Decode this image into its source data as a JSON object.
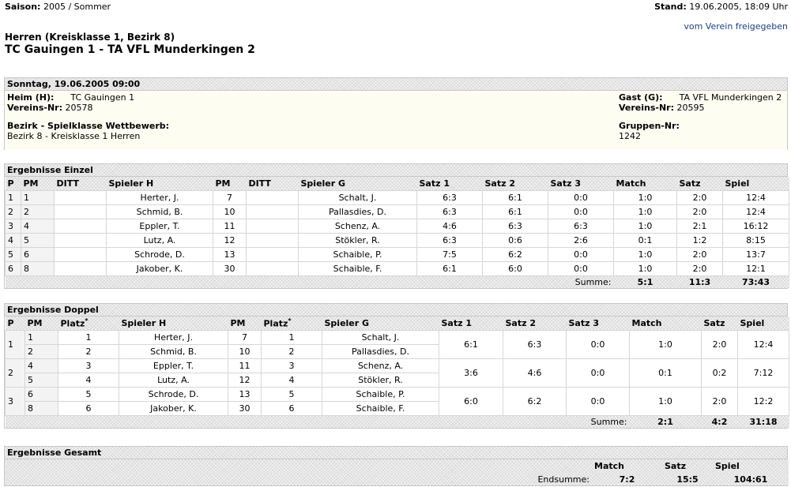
{
  "header": {
    "saison_label": "Saison:",
    "saison_value": "2005 / Sommer",
    "stand_label": "Stand:",
    "stand_value": "19.06.2005, 18:09 Uhr",
    "freigabe": "vom Verein freigegeben",
    "league": "Herren (Kreisklasse 1, Bezirk 8)",
    "match": "TC Gauingen 1 - TA VFL Munderkingen 2"
  },
  "info": {
    "date": "Sonntag, 19.06.2005 09:00",
    "heim_label": "Heim (H):",
    "heim_value": "TC Gauingen 1",
    "heim_nr_label": "Vereins-Nr:",
    "heim_nr_value": "20578",
    "gast_label": "Gast (G):",
    "gast_value": "TA VFL Munderkingen 2",
    "gast_nr_label": "Vereins-Nr:",
    "gast_nr_value": "20595",
    "bezirk_label": "Bezirk - Spielklasse Wettbewerb:",
    "bezirk_value": "Bezirk 8 - Kreisklasse 1 Herren",
    "gruppe_label": "Gruppen-Nr:",
    "gruppe_value": "1242"
  },
  "einzel": {
    "title": "Ergebnisse Einzel",
    "headers": [
      "P",
      "PM",
      "DITT",
      "Spieler H",
      "PM",
      "DITT",
      "Spieler G",
      "Satz 1",
      "Satz 2",
      "Satz 3",
      "Match",
      "Satz",
      "Spiel"
    ],
    "rows": [
      [
        "1",
        "1",
        "",
        "Herter, J.",
        "7",
        "",
        "Schalt, J.",
        "6:3",
        "6:1",
        "0:0",
        "1:0",
        "2:0",
        "12:4"
      ],
      [
        "2",
        "2",
        "",
        "Schmid, B.",
        "10",
        "",
        "Pallasdies, D.",
        "6:3",
        "6:1",
        "0:0",
        "1:0",
        "2:0",
        "12:4"
      ],
      [
        "3",
        "4",
        "",
        "Eppler, T.",
        "11",
        "",
        "Schenz, A.",
        "4:6",
        "6:3",
        "6:3",
        "1:0",
        "2:1",
        "16:12"
      ],
      [
        "4",
        "5",
        "",
        "Lutz, A.",
        "12",
        "",
        "Stökler, R.",
        "6:3",
        "0:6",
        "2:6",
        "0:1",
        "1:2",
        "8:15"
      ],
      [
        "5",
        "6",
        "",
        "Schrode, D.",
        "13",
        "",
        "Schaible, P.",
        "7:5",
        "6:2",
        "0:0",
        "1:0",
        "2:0",
        "13:7"
      ],
      [
        "6",
        "8",
        "",
        "Jakober, K.",
        "30",
        "",
        "Schaible, F.",
        "6:1",
        "6:0",
        "0:0",
        "1:0",
        "2:0",
        "12:1"
      ]
    ],
    "sum_label": "Summe:",
    "sum_match": "5:1",
    "sum_satz": "11:3",
    "sum_spiel": "73:43"
  },
  "doppel": {
    "title": "Ergebnisse Doppel",
    "headers": [
      "P",
      "PM",
      "Platz",
      "Spieler H",
      "PM",
      "Platz",
      "Spieler G",
      "Satz 1",
      "Satz 2",
      "Satz 3",
      "Match",
      "Satz",
      "Spiel"
    ],
    "star": "*",
    "pairs": [
      {
        "p": "1",
        "players": [
          [
            "1",
            "1",
            "Herter, J.",
            "7",
            "1",
            "Schalt, J."
          ],
          [
            "2",
            "2",
            "Schmid, B.",
            "10",
            "2",
            "Pallasdies, D."
          ]
        ],
        "results": [
          "6:1",
          "6:3",
          "0:0",
          "1:0",
          "2:0",
          "12:4"
        ]
      },
      {
        "p": "2",
        "players": [
          [
            "4",
            "3",
            "Eppler, T.",
            "11",
            "3",
            "Schenz, A."
          ],
          [
            "5",
            "4",
            "Lutz, A.",
            "12",
            "4",
            "Stökler, R."
          ]
        ],
        "results": [
          "3:6",
          "4:6",
          "0:0",
          "0:1",
          "0:2",
          "7:12"
        ]
      },
      {
        "p": "3",
        "players": [
          [
            "6",
            "5",
            "Schrode, D.",
            "13",
            "5",
            "Schaible, P."
          ],
          [
            "8",
            "6",
            "Jakober, K.",
            "30",
            "6",
            "Schaible, F."
          ]
        ],
        "results": [
          "6:0",
          "6:2",
          "0:0",
          "1:0",
          "2:0",
          "12:2"
        ]
      }
    ],
    "sum_label": "Summe:",
    "sum_match": "2:1",
    "sum_satz": "4:2",
    "sum_spiel": "31:18"
  },
  "gesamt": {
    "title": "Ergebnisse Gesamt",
    "headers": [
      "Match",
      "Satz",
      "Spiel"
    ],
    "sum_label": "Endsumme:",
    "match": "7:2",
    "satz": "15:5",
    "spiel": "104:61"
  }
}
